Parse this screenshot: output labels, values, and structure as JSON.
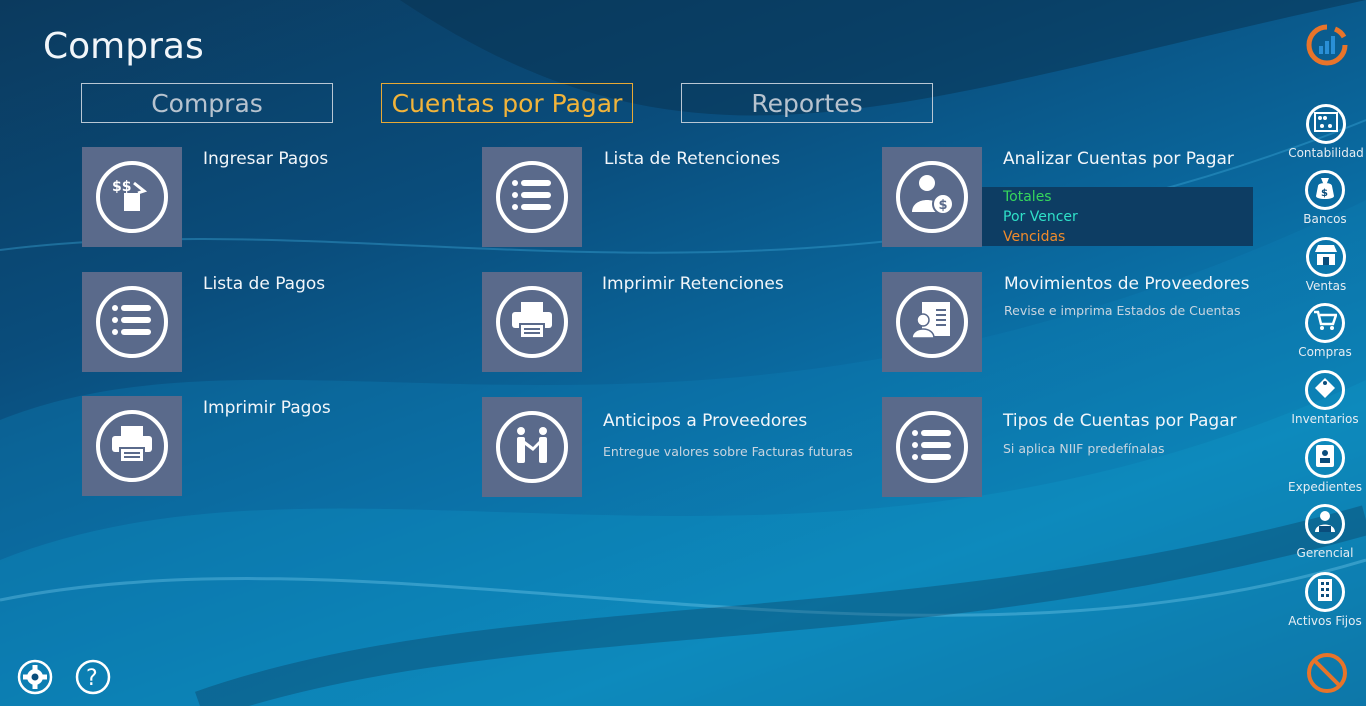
{
  "page": {
    "title": "Compras"
  },
  "tabs": [
    {
      "label": "Compras",
      "active": false
    },
    {
      "label": "Cuentas por Pagar",
      "active": true
    },
    {
      "label": "Reportes",
      "active": false
    }
  ],
  "items": [
    {
      "title": "Ingresar Pagos",
      "subtitle": "",
      "icon": "payment-icon"
    },
    {
      "title": "Lista de Pagos",
      "subtitle": "",
      "icon": "list-icon"
    },
    {
      "title": "Imprimir Pagos",
      "subtitle": "",
      "icon": "printer-icon"
    },
    {
      "title": "Lista de Retenciones",
      "subtitle": "",
      "icon": "list-icon"
    },
    {
      "title": "Imprimir Retenciones",
      "subtitle": "",
      "icon": "printer-icon"
    },
    {
      "title": "Anticipos a Proveedores",
      "subtitle": "Entregue valores sobre Facturas futuras",
      "icon": "handshake-icon"
    },
    {
      "title": "Analizar Cuentas por Pagar",
      "subtitle": "",
      "icon": "person-money-icon"
    },
    {
      "title": "Movimientos de Proveedores",
      "subtitle": "Revise e imprima Estados de Cuentas",
      "icon": "supplier-statement-icon"
    },
    {
      "title": "Tipos de Cuentas por Pagar",
      "subtitle": "Si aplica NIIF predefínalas",
      "icon": "list-icon"
    }
  ],
  "analysis_options": [
    {
      "label": "Totales",
      "color": "#36d65c"
    },
    {
      "label": "Por Vencer",
      "color": "#2fe0c8"
    },
    {
      "label": "Vencidas",
      "color": "#f08a2a"
    }
  ],
  "sidebar": [
    {
      "label": "Contabilidad",
      "icon": "abacus-icon"
    },
    {
      "label": "Bancos",
      "icon": "money-bag-icon"
    },
    {
      "label": "Ventas",
      "icon": "store-icon"
    },
    {
      "label": "Compras",
      "icon": "cart-icon"
    },
    {
      "label": "Inventarios",
      "icon": "tag-icon"
    },
    {
      "label": "Expedientes",
      "icon": "id-card-icon"
    },
    {
      "label": "Gerencial",
      "icon": "manager-icon"
    },
    {
      "label": "Activos Fijos",
      "icon": "building-icon"
    }
  ],
  "colors": {
    "accent": "#f2b43a",
    "tile": "#5a6a8b",
    "logo": "#e8742a"
  }
}
